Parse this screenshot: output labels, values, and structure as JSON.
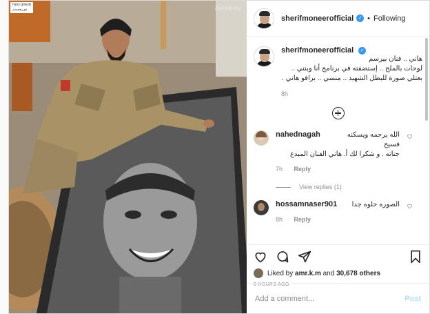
{
  "media": {
    "overlay_credit_line1": "hany gmedy",
    "overlay_credit_line2": "ةوريفعمنم",
    "signature": "Bouabaty"
  },
  "header": {
    "username": "sherifmoneerofficial",
    "verified_mark": "✓",
    "separator": "•",
    "follow_state": "Following"
  },
  "caption": {
    "username": "sherifmoneerofficial",
    "text_lines": [
      "هاني .. فنان بيرسم",
      "لوحات بالملح .. إستضفته في برنامج أنا وبنتي ..",
      "بعتلي صورة للبطل الشهيد .. منسي .. برافو هاني ."
    ],
    "time": "8h"
  },
  "load_more": {
    "icon": "plus-circle-icon"
  },
  "comments": [
    {
      "username": "nahednagah",
      "text_lines": [
        "الله يرحمه ويسكنه فسيح",
        "جناته . و شكرا لك أ. هاني الفنان المبدع"
      ],
      "time": "7h",
      "reply_label": "Reply",
      "avatar_color": "#d9c9b5"
    },
    {
      "username": "hossamnaser901",
      "text_lines": [
        "الصوره حلوه جدا"
      ],
      "time": "8h",
      "reply_label": "Reply",
      "avatar_color": "#3a3a3a"
    }
  ],
  "view_replies": "View replies (1)",
  "actions": {
    "like_icon": "heart-icon",
    "comment_icon": "comment-icon",
    "share_icon": "share-icon",
    "save_icon": "bookmark-icon"
  },
  "likes": {
    "prefix": "Liked by ",
    "user": "amr.k.m",
    "middle": " and ",
    "others": "30,678 others"
  },
  "timestamp": "8 HOURS AGO",
  "add_comment": {
    "placeholder": "Add a comment...",
    "post_label": "Post"
  },
  "colors": {
    "accent": "#3897f0",
    "post_disabled": "#b2dffc",
    "muted": "#8e8e8e"
  }
}
